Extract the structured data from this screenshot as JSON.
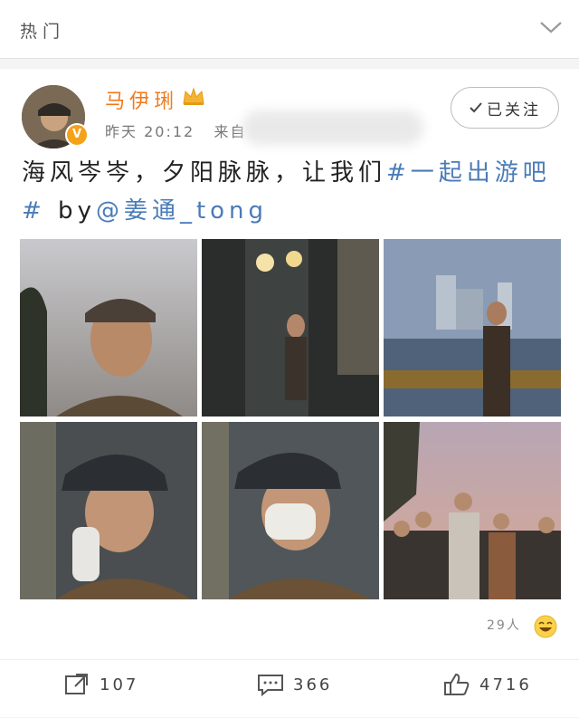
{
  "header": {
    "title": "热门",
    "chevron_icon": "chevron-down-icon"
  },
  "post": {
    "username": "马伊琍",
    "time": "昨天 20:12",
    "source_prefix": "来自",
    "follow_label": "已关注",
    "text_plain": "海风岑岑，夕阳脉脉，让我们",
    "topic": "#一起出游吧#",
    "by": " by",
    "mention": "@姜通_tong",
    "liked_count": "29人",
    "actions": {
      "repost": "107",
      "comment": "366",
      "like": "4716"
    }
  },
  "colors": {
    "username": "#f07a1a",
    "link": "#4a7bb7",
    "badge": "#f3a21a"
  },
  "photos": [
    "photo-1",
    "photo-2",
    "photo-3",
    "photo-4",
    "photo-5",
    "photo-6"
  ]
}
